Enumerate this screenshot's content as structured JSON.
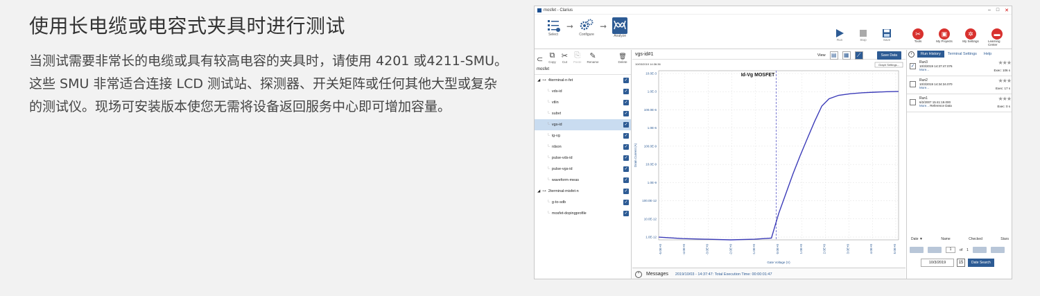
{
  "heading": "使用长电缆或电容式夹具时进行测试",
  "paragraph": "当测试需要非常长的电缆或具有较高电容的夹具时，请使用 4201 或4211-SMU。这些 SMU 非常适合连接 LCD 测试站、探测器、开关矩阵或任何其他大型或复杂的测试仪。现场可安装版本使您无需将设备返回服务中心即可增加容量。",
  "app": {
    "window_title": "mosfet - Clarius",
    "window_controls": [
      "–",
      "□",
      "✕"
    ],
    "close_label": "Close",
    "steps": [
      {
        "label": "Select",
        "icon": "list-icon"
      },
      {
        "label": "Configure",
        "icon": "gears-icon"
      },
      {
        "label": "Analyze",
        "icon": "analyze-icon"
      }
    ],
    "run_tools": [
      {
        "label": "Run",
        "icon": "play-icon"
      },
      {
        "label": "Stop",
        "icon": "stop-icon"
      },
      {
        "label": "Save",
        "icon": "save-icon"
      }
    ],
    "right_tools": [
      {
        "label": "Tools",
        "glyph": "✂"
      },
      {
        "label": "My Projects",
        "glyph": "▣"
      },
      {
        "label": "My Settings",
        "glyph": "✲"
      },
      {
        "label": "Learning Center",
        "glyph": "▬"
      }
    ],
    "left_tools": [
      {
        "label": "Copy",
        "glyph": "⧉"
      },
      {
        "label": "Cut",
        "glyph": "✂"
      },
      {
        "label": "Paste",
        "glyph": "⎘"
      },
      {
        "label": "Rename",
        "glyph": "✎"
      },
      {
        "label": "Delete",
        "glyph": "🗑"
      }
    ],
    "project_name": "mosfet",
    "tree": [
      {
        "label": "4terminal-n-fet",
        "level": 0,
        "selected": false
      },
      {
        "label": "vds-id",
        "level": 1,
        "selected": false
      },
      {
        "label": "vtlin",
        "level": 1,
        "selected": false
      },
      {
        "label": "subvt",
        "level": 1,
        "selected": false
      },
      {
        "label": "vgs-id",
        "level": 1,
        "selected": true
      },
      {
        "label": "ig-vg",
        "level": 1,
        "selected": false
      },
      {
        "label": "rdson",
        "level": 1,
        "selected": false
      },
      {
        "label": "pulse-vds-id",
        "level": 1,
        "selected": false
      },
      {
        "label": "pulse-vgs-id",
        "level": 1,
        "selected": false
      },
      {
        "label": "waveform-meas",
        "level": 1,
        "selected": false
      },
      {
        "label": "2terminal-misfet-n",
        "level": 0,
        "selected": false
      },
      {
        "label": "g-to-sdb",
        "level": 1,
        "selected": false
      },
      {
        "label": "mosfet-dopingprofile",
        "level": 1,
        "selected": false
      }
    ],
    "center_title": "vgs-id#1",
    "view_label": "View",
    "save_data": "Save Data",
    "graph_settings": "Graph Settings...",
    "timestamp": "10/03/2019 14:36:36",
    "messages_label": "Messages",
    "message_text": "2019/10/03 - 14:37:47: Total Execution Time: 00:00:01:47",
    "right_tabs": [
      "Run History",
      "Terminal Settings",
      "Help"
    ],
    "runs": [
      {
        "name": "Run3",
        "date": "10/3/2019 14:37:47.076",
        "exec": "Exec: 106 s",
        "checked": true,
        "note": ""
      },
      {
        "name": "Run2",
        "date": "10/3/2019 14:34:34.070",
        "exec": "Exec: 17 s",
        "checked": false,
        "note": ""
      },
      {
        "name": "Run1",
        "date": "6/2/2007 15:41:19.000",
        "exec": "Exec: 0 s",
        "checked": false,
        "note": "Reference Data"
      }
    ],
    "more_label": "More...",
    "stars": "★★★",
    "history_headers": [
      "Date ▼",
      "Name",
      "Checked",
      "Stars"
    ],
    "pager": {
      "page": "1",
      "of_label": "of",
      "total": "1"
    },
    "date_value": "10/3/2019",
    "date_search": "Date Search",
    "calendar_day": "15"
  },
  "chart_data": {
    "type": "line",
    "title": "Id-Vg MOSFET",
    "xlabel": "Gate Voltage (V)",
    "ylabel": "Drain Current (A)",
    "xlim": [
      -5,
      5
    ],
    "x_ticks": [
      "-5.0E+0",
      "-4.0E+0",
      "-3.0E+0",
      "-2.0E+0",
      "-1.0E+0",
      "0.0E+0",
      "1.0E+0",
      "2.0E+0",
      "3.0E+0",
      "4.0E+0",
      "5.0E+0"
    ],
    "y_scale": "log",
    "ylim": [
      1e-14,
      0.001
    ],
    "y_ticks": [
      "10.0E-3",
      "1.0E-3",
      "100.0E-6",
      "1.0E-6",
      "100.0E-9",
      "10.0E-9",
      "1.0E-9",
      "100.0E-12",
      "10.0E-12",
      "1.0E-12"
    ],
    "marker_x": -0.1,
    "series": [
      {
        "color": "#3b3bb8",
        "x": [
          -5,
          -4,
          -3,
          -2,
          -1,
          -0.3,
          0,
          0.3,
          0.6,
          0.9,
          1.2,
          1.5,
          1.8,
          2.1,
          2.5,
          3,
          3.5,
          4,
          4.5,
          5
        ],
        "y": [
          1.5e-14,
          1.2e-14,
          1.1e-14,
          1e-14,
          1.1e-14,
          1.3e-14,
          5e-13,
          1e-11,
          2e-10,
          3e-09,
          4e-08,
          5e-07,
          5e-06,
          1.5e-05,
          2.5e-05,
          3.2e-05,
          3.7e-05,
          4e-05,
          4.3e-05,
          4.5e-05
        ]
      }
    ],
    "grid": true
  }
}
